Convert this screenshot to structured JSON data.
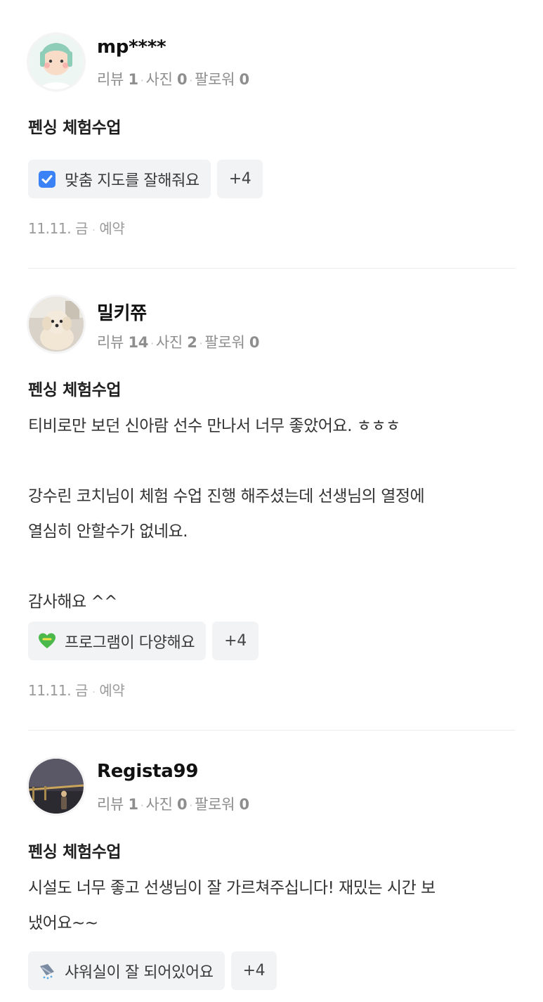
{
  "reviews": [
    {
      "user": "mp****",
      "stats": {
        "review_label": "리뷰",
        "review_count": "1",
        "photo_label": "사진",
        "photo_count": "0",
        "follower_label": "팔로워",
        "follower_count": "0"
      },
      "title": "펜싱 체험수업",
      "body": "",
      "tag": {
        "icon": "checkmark-box-icon",
        "label": "맞춤 지도를 잘해줘요"
      },
      "more_tags": "+4",
      "date": "11.11. 금",
      "visit_type": "예약"
    },
    {
      "user": "밀키쮸",
      "stats": {
        "review_label": "리뷰",
        "review_count": "14",
        "photo_label": "사진",
        "photo_count": "2",
        "follower_label": "팔로워",
        "follower_count": "0"
      },
      "title": "펜싱 체험수업",
      "body": "티비로만 보던 신아람 선수 만나서 너무 좋았어요. ㅎㅎㅎ\n\n강수린 코치님이 체험 수업 진행 해주셨는데 선생님의 열정에\n열심히 안할수가 없네요.\n\n감사해요 ^^",
      "tag": {
        "icon": "green-heart-icon",
        "label": "프로그램이 다양해요"
      },
      "more_tags": "+4",
      "date": "11.11. 금",
      "visit_type": "예약"
    },
    {
      "user": "Regista99",
      "stats": {
        "review_label": "리뷰",
        "review_count": "1",
        "photo_label": "사진",
        "photo_count": "0",
        "follower_label": "팔로워",
        "follower_count": "0"
      },
      "title": "펜싱 체험수업",
      "body": "시설도 너무 좋고 선생님이 잘 가르쳐주십니다! 재밌는 시간 보\n냈어요~~",
      "tag": {
        "icon": "shower-icon",
        "label": "샤워실이 잘 되어있어요"
      },
      "more_tags": "+4",
      "date": "",
      "visit_type": ""
    }
  ],
  "colors": {
    "tag_bg": "#f2f3f5",
    "muted_text": "#8e8e8e",
    "divider": "#ececec"
  }
}
